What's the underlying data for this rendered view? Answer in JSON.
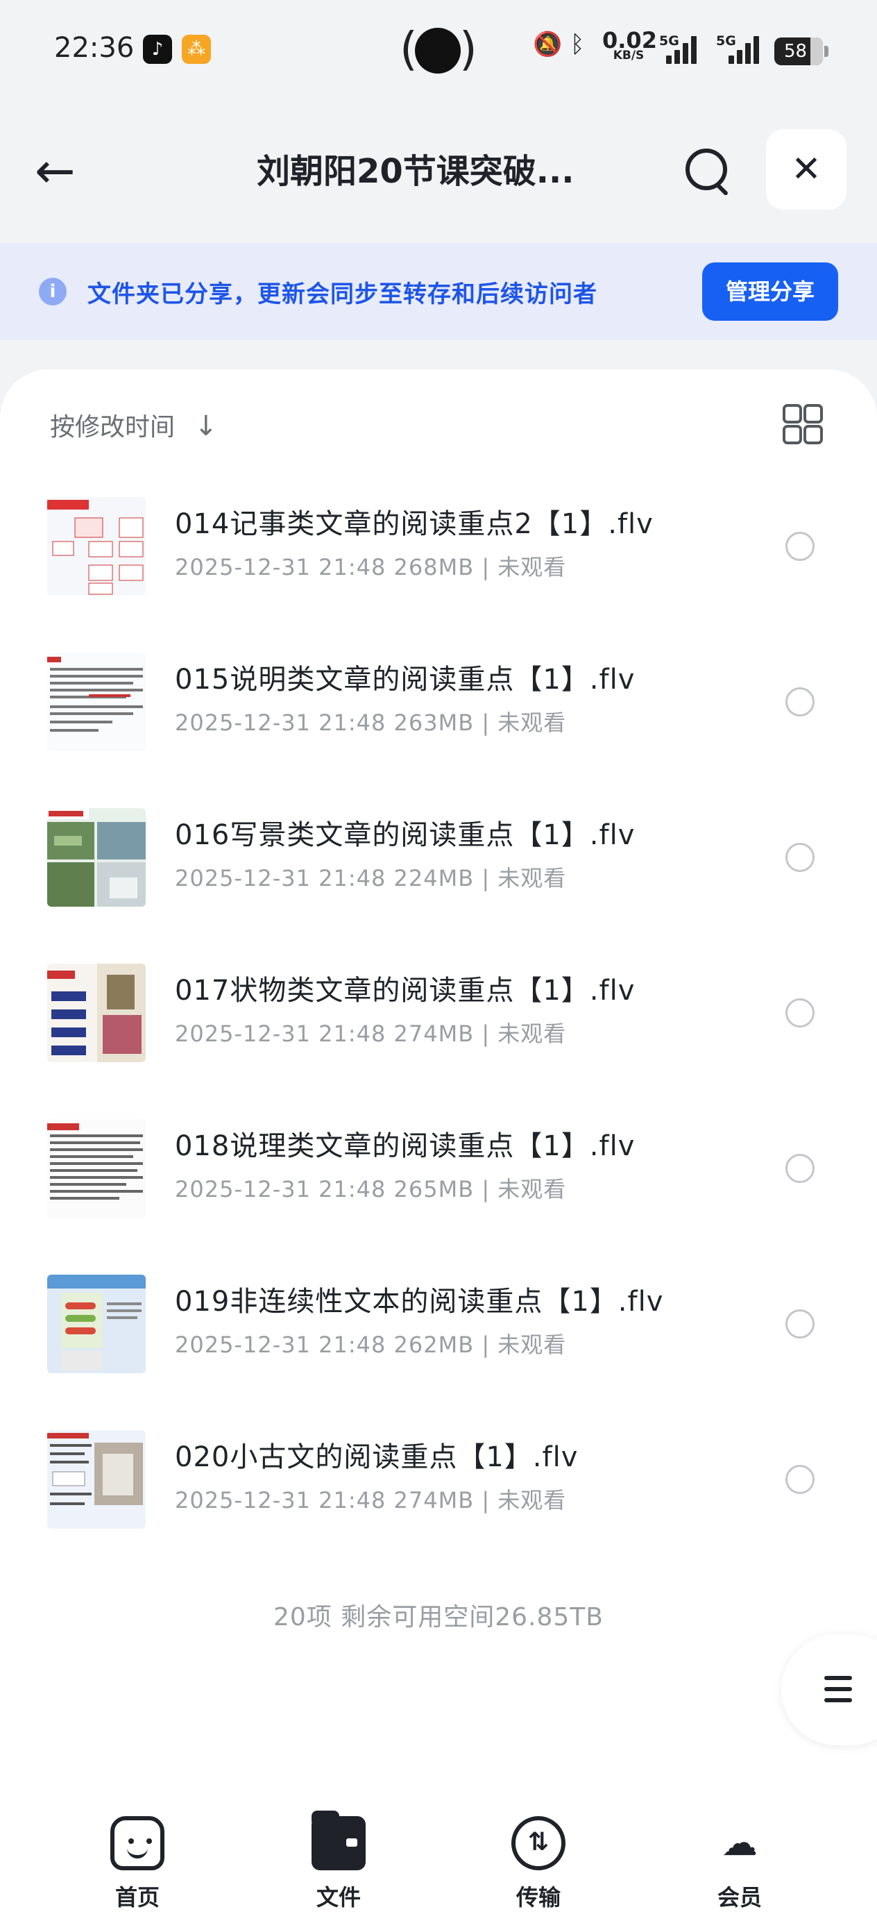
{
  "status_bar": {
    "time": "22:36",
    "net_speed": "0.02",
    "net_unit": "KB/S",
    "sim1": "5G",
    "sim2": "5G",
    "battery": "58"
  },
  "header": {
    "title": "刘朝阳20节课突破...",
    "back_icon": "arrow-left-icon",
    "search_icon": "search-icon",
    "close_icon": "close-icon",
    "close_glyph": "✕"
  },
  "notice": {
    "icon_glyph": "i",
    "message": "文件夹已分享，更新会同步至转存和后续访问者",
    "manage_label": "管理分享"
  },
  "toolbar": {
    "sort_label": "按修改时间",
    "sort_arrow": "↓"
  },
  "files": [
    {
      "name": "014记事类文章的阅读重点2【1】.flv",
      "meta": "2025-12-31 21:48 268MB | 未观看"
    },
    {
      "name": "015说明类文章的阅读重点【1】.flv",
      "meta": "2025-12-31 21:48 263MB | 未观看"
    },
    {
      "name": "016写景类文章的阅读重点【1】.flv",
      "meta": "2025-12-31 21:48 224MB | 未观看"
    },
    {
      "name": "017状物类文章的阅读重点【1】.flv",
      "meta": "2025-12-31 21:48 274MB | 未观看"
    },
    {
      "name": "018说理类文章的阅读重点【1】.flv",
      "meta": "2025-12-31 21:48 265MB | 未观看"
    },
    {
      "name": "019非连续性文本的阅读重点【1】.flv",
      "meta": "2025-12-31 21:48 262MB | 未观看"
    },
    {
      "name": "020小古文的阅读重点【1】.flv",
      "meta": "2025-12-31 21:48 274MB | 未观看"
    }
  ],
  "footer": {
    "count_text": "20项 剩余可用空间26.85TB"
  },
  "nav": [
    {
      "label": "首页",
      "icon": "home-face-icon"
    },
    {
      "label": "文件",
      "icon": "wallet-folder-icon"
    },
    {
      "label": "传输",
      "icon": "transfer-icon"
    },
    {
      "label": "会员",
      "icon": "member-cloud-icon"
    }
  ],
  "colors": {
    "accent": "#1760f4",
    "notice_bg": "#e8ebfa",
    "notice_text": "#1d55e8"
  }
}
